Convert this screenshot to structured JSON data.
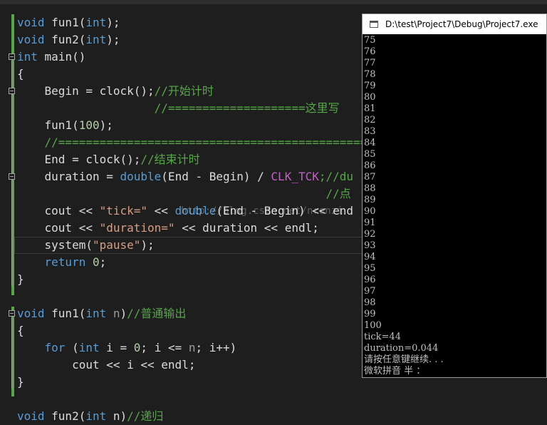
{
  "editor": {
    "lines": [
      {
        "parts": [
          {
            "t": "void",
            "c": "kw"
          },
          {
            "t": " fun1(",
            "c": ""
          },
          {
            "t": "int",
            "c": "kw"
          },
          {
            "t": ");",
            "c": ""
          }
        ]
      },
      {
        "parts": [
          {
            "t": "void",
            "c": "kw"
          },
          {
            "t": " fun2(",
            "c": ""
          },
          {
            "t": "int",
            "c": "kw"
          },
          {
            "t": ");",
            "c": ""
          }
        ]
      },
      {
        "parts": [
          {
            "t": "int",
            "c": "kw"
          },
          {
            "t": " main()",
            "c": ""
          }
        ]
      },
      {
        "parts": [
          {
            "t": "{",
            "c": ""
          }
        ]
      },
      {
        "parts": [
          {
            "t": "    Begin = clock();",
            "c": ""
          },
          {
            "t": "//开始计时",
            "c": "cm"
          }
        ]
      },
      {
        "parts": [
          {
            "t": "                    //====================这里写",
            "c": "cm"
          }
        ]
      },
      {
        "parts": [
          {
            "t": "    fun1(",
            "c": ""
          },
          {
            "t": "100",
            "c": "nm"
          },
          {
            "t": ");",
            "c": ""
          }
        ]
      },
      {
        "parts": [
          {
            "t": "    //==============================================",
            "c": "cm"
          }
        ]
      },
      {
        "parts": [
          {
            "t": "    End = clock();",
            "c": ""
          },
          {
            "t": "//结束计时",
            "c": "cm"
          }
        ]
      },
      {
        "parts": [
          {
            "t": "    duration = ",
            "c": ""
          },
          {
            "t": "double",
            "c": "kw"
          },
          {
            "t": "(End - Begin) / ",
            "c": ""
          },
          {
            "t": "CLK_TCK",
            "c": "mc"
          },
          {
            "t": ";//du",
            "c": "cm"
          }
        ]
      },
      {
        "parts": [
          {
            "t": "                                             //点",
            "c": "cm"
          }
        ]
      },
      {
        "parts": [
          {
            "t": "    cout << ",
            "c": ""
          },
          {
            "t": "\"tick=\"",
            "c": "st"
          },
          {
            "t": " << ",
            "c": ""
          },
          {
            "t": "double",
            "c": "kw"
          },
          {
            "t": "(End - Begin) << end",
            "c": ""
          }
        ]
      },
      {
        "parts": [
          {
            "t": "    cout << ",
            "c": ""
          },
          {
            "t": "\"duration=\"",
            "c": "st"
          },
          {
            "t": " << duration << endl;",
            "c": ""
          }
        ]
      },
      {
        "parts": [
          {
            "t": "    system(",
            "c": ""
          },
          {
            "t": "\"pause\"",
            "c": "st"
          },
          {
            "t": ");",
            "c": ""
          }
        ]
      },
      {
        "parts": [
          {
            "t": "    ",
            "c": ""
          },
          {
            "t": "return",
            "c": "kw"
          },
          {
            "t": " ",
            "c": ""
          },
          {
            "t": "0",
            "c": "nm"
          },
          {
            "t": ";",
            "c": ""
          }
        ]
      },
      {
        "parts": [
          {
            "t": "}",
            "c": ""
          }
        ]
      },
      {
        "parts": [
          {
            "t": "",
            "c": ""
          }
        ]
      },
      {
        "parts": [
          {
            "t": "void",
            "c": "kw"
          },
          {
            "t": " fun1(",
            "c": ""
          },
          {
            "t": "int",
            "c": "kw"
          },
          {
            "t": " ",
            "c": ""
          },
          {
            "t": "n",
            "c": "pm"
          },
          {
            "t": ")",
            "c": ""
          },
          {
            "t": "//普通输出",
            "c": "cm"
          }
        ]
      },
      {
        "parts": [
          {
            "t": "{",
            "c": ""
          }
        ]
      },
      {
        "parts": [
          {
            "t": "    ",
            "c": ""
          },
          {
            "t": "for",
            "c": "kw"
          },
          {
            "t": " (",
            "c": ""
          },
          {
            "t": "int",
            "c": "kw"
          },
          {
            "t": " i = ",
            "c": ""
          },
          {
            "t": "0",
            "c": "nm"
          },
          {
            "t": "; i <= ",
            "c": ""
          },
          {
            "t": "n",
            "c": "pm"
          },
          {
            "t": "; i++)",
            "c": ""
          }
        ]
      },
      {
        "parts": [
          {
            "t": "        cout << i << endl;",
            "c": ""
          }
        ]
      },
      {
        "parts": [
          {
            "t": "}",
            "c": ""
          }
        ]
      },
      {
        "parts": [
          {
            "t": "",
            "c": ""
          }
        ]
      },
      {
        "parts": [
          {
            "t": "void",
            "c": "kw"
          },
          {
            "t": " fun2(",
            "c": ""
          },
          {
            "t": "int",
            "c": "kw"
          },
          {
            "t": " n)",
            "c": ""
          },
          {
            "t": "//递归",
            "c": "cm"
          }
        ]
      }
    ],
    "watermark": "http://blog.csdn.net/nrenzi"
  },
  "console": {
    "title": "D:\\test\\Project7\\Debug\\Project7.exe",
    "lines": [
      "75",
      "76",
      "77",
      "78",
      "79",
      "80",
      "81",
      "82",
      "83",
      "84",
      "85",
      "86",
      "87",
      "88",
      "89",
      "90",
      "91",
      "92",
      "93",
      "94",
      "95",
      "96",
      "97",
      "98",
      "99",
      "100",
      "tick=44",
      "duration=0.044",
      "请按任意键继续. . .",
      "微软拼音 半 ："
    ]
  },
  "colors": {
    "keyword": "#569cd6",
    "comment": "#57a64a",
    "string": "#d69d85",
    "macro": "#bd63c5",
    "number": "#b5cea8",
    "background": "#1e1e1e",
    "console_bg": "#000000"
  }
}
